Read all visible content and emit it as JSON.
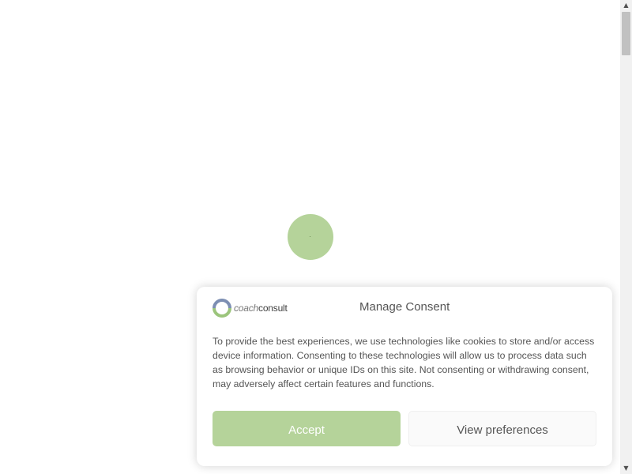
{
  "colors": {
    "accent": "#b5d39a",
    "text": "#555555",
    "background": "#ffffff"
  },
  "loader": {
    "icon": "loading-spinner-icon"
  },
  "consent": {
    "logo": {
      "icon": "coachconsult-logo-icon",
      "word_light": "coach",
      "word_bold": "consult"
    },
    "title": "Manage Consent",
    "message": "To provide the best experiences, we use technologies like cookies to store and/or access device information. Consenting to these technologies will allow us to process data such as browsing behavior or unique IDs on this site. Not consenting or withdrawing consent, may adversely affect certain features and functions.",
    "buttons": {
      "accept_label": "Accept",
      "preferences_label": "View preferences"
    }
  },
  "scrollbar": {
    "up_icon": "scroll-up-arrow-icon",
    "down_icon": "scroll-down-arrow-icon"
  }
}
